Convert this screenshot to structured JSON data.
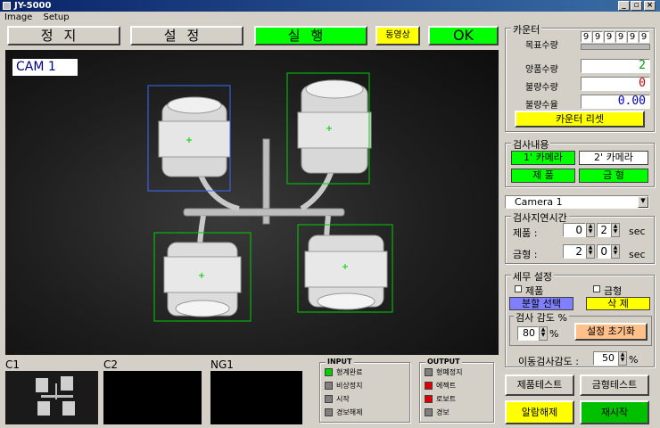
{
  "window": {
    "title": "JY-5000",
    "min_glyph": "_",
    "max_glyph": "▫",
    "close_glyph": "×"
  },
  "menu": [
    "Image",
    "Setup"
  ],
  "toolbar": {
    "stop": "정지",
    "settings": "설정",
    "run": "실행",
    "video": "동영상",
    "status": "OK"
  },
  "camera_view": {
    "label": "CAM 1"
  },
  "thumbnails": {
    "c1": "C1",
    "c2": "C2",
    "ng1": "NG1"
  },
  "input": {
    "title": "INPUT",
    "items": [
      {
        "label": "형계완료",
        "color": "#00d000"
      },
      {
        "label": "비상정지",
        "color": "#808080"
      },
      {
        "label": "시작",
        "color": "#808080"
      },
      {
        "label": "경보해제",
        "color": "#808080"
      }
    ]
  },
  "output": {
    "title": "OUTPUT",
    "items": [
      {
        "label": "형폐정지",
        "color": "#808080"
      },
      {
        "label": "에젝트",
        "color": "#e00000"
      },
      {
        "label": "로보트",
        "color": "#e00000"
      },
      {
        "label": "경보",
        "color": "#808080"
      }
    ]
  },
  "counter": {
    "title": "카운터",
    "target_label": "목표수량",
    "target_digits": [
      "9",
      "9",
      "9",
      "9",
      "9",
      "9"
    ],
    "good_label": "양품수량",
    "good_value": "2",
    "bad_label": "불량수량",
    "bad_value": "0",
    "rate_label": "불량수율",
    "rate_value": "0.00",
    "reset_button": "카운터 리셋"
  },
  "inspection": {
    "title": "검사내용",
    "cam1": "1' 카메라",
    "cam2": "2' 카메라",
    "product": "제 품",
    "mold": "금 형"
  },
  "camera_select": {
    "value": "Camera 1"
  },
  "delay": {
    "title": "검사지연시간",
    "product_label": "제품 :",
    "product_a": "0",
    "product_b": "2",
    "mold_label": "금형 :",
    "mold_a": "2",
    "mold_b": "0",
    "unit": "sec"
  },
  "detail": {
    "title": "세무 설정",
    "product_check": "제품",
    "mold_check": "금형",
    "select_area": "분할 선택",
    "delete": "삭 제",
    "sensitivity_title": "검사 감도 %",
    "sensitivity_value": "80",
    "percent": "%",
    "reset_settings": "설정 초기화",
    "move_sensitivity_label": "이동검사감도 :",
    "move_sensitivity_value": "50"
  },
  "bottom_buttons": {
    "product_test": "제품테스트",
    "mold_test": "금형테스트",
    "alarm_off": "알람해제",
    "restart": "재시작"
  }
}
